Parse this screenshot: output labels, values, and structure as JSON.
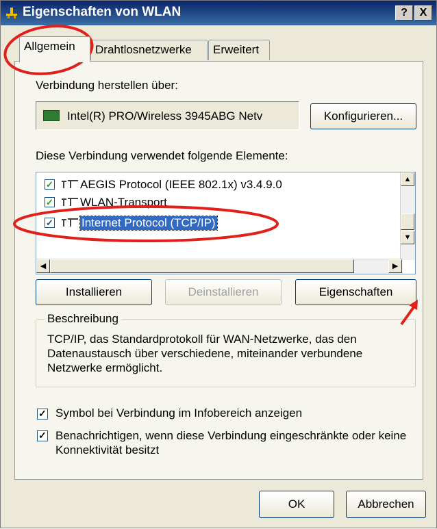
{
  "window": {
    "title": "Eigenschaften von WLAN",
    "help_label": "?",
    "close_label": "X"
  },
  "tabs": [
    {
      "label": "Allgemein"
    },
    {
      "label": "Drahtlosnetzwerke"
    },
    {
      "label": "Erweitert"
    }
  ],
  "connection": {
    "connect_via_label": "Verbindung herstellen über:",
    "adapter_name": "Intel(R) PRO/Wireless 3945ABG Netv",
    "configure_button": "Konfigurieren..."
  },
  "elements": {
    "heading": "Diese Verbindung verwendet folgende Elemente:",
    "items": [
      {
        "label": "AEGIS Protocol (IEEE 802.1x) v3.4.9.0",
        "checked": true,
        "selected": false
      },
      {
        "label": "WLAN-Transport",
        "checked": true,
        "selected": false
      },
      {
        "label": "Internet Protocol (TCP/IP)",
        "checked": true,
        "selected": true
      }
    ]
  },
  "buttons": {
    "install": "Installieren",
    "uninstall": "Deinstallieren",
    "properties": "Eigenschaften"
  },
  "description": {
    "legend": "Beschreibung",
    "text": "TCP/IP, das Standardprotokoll für WAN-Netzwerke, das den Datenaustausch über verschiedene, miteinander verbundene Netzwerke ermöglicht."
  },
  "options": {
    "show_icon": "Symbol bei Verbindung im Infobereich anzeigen",
    "notify": "Benachrichtigen, wenn diese Verbindung eingeschränkte oder keine Konnektivität besitzt"
  },
  "footer": {
    "ok": "OK",
    "cancel": "Abbrechen"
  },
  "colors": {
    "titlebar": "#0a246a",
    "selection": "#316ac5",
    "annotation": "#e0201a"
  }
}
